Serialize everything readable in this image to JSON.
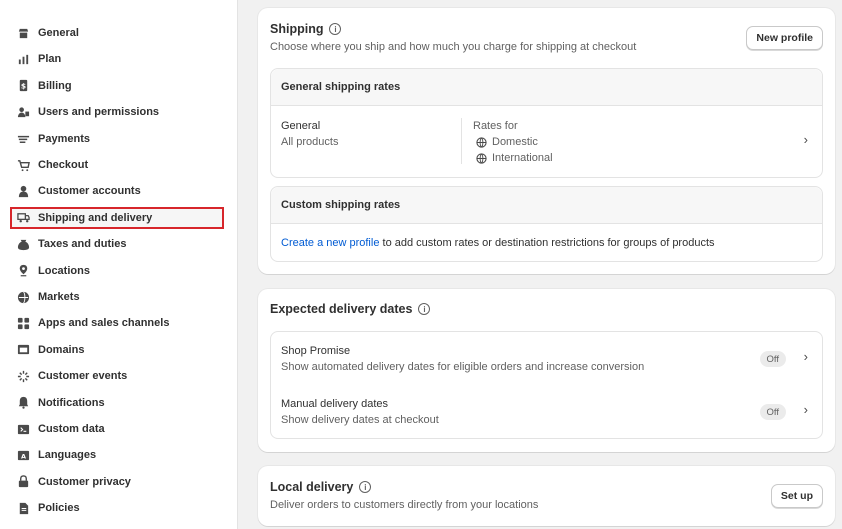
{
  "sidebar": {
    "items": [
      {
        "label": "General",
        "icon": "store-icon"
      },
      {
        "label": "Plan",
        "icon": "plan-icon"
      },
      {
        "label": "Billing",
        "icon": "billing-icon"
      },
      {
        "label": "Users and permissions",
        "icon": "users-icon"
      },
      {
        "label": "Payments",
        "icon": "payments-icon"
      },
      {
        "label": "Checkout",
        "icon": "cart-icon"
      },
      {
        "label": "Customer accounts",
        "icon": "person-icon"
      },
      {
        "label": "Shipping and delivery",
        "icon": "truck-icon"
      },
      {
        "label": "Taxes and duties",
        "icon": "tax-icon"
      },
      {
        "label": "Locations",
        "icon": "location-icon"
      },
      {
        "label": "Markets",
        "icon": "globe-icon"
      },
      {
        "label": "Apps and sales channels",
        "icon": "apps-icon"
      },
      {
        "label": "Domains",
        "icon": "domains-icon"
      },
      {
        "label": "Customer events",
        "icon": "events-icon"
      },
      {
        "label": "Notifications",
        "icon": "bell-icon"
      },
      {
        "label": "Custom data",
        "icon": "data-icon"
      },
      {
        "label": "Languages",
        "icon": "language-icon"
      },
      {
        "label": "Customer privacy",
        "icon": "lock-icon"
      },
      {
        "label": "Policies",
        "icon": "policy-icon"
      }
    ],
    "active_index": 7
  },
  "shipping": {
    "title": "Shipping",
    "subtitle": "Choose where you ship and how much you charge for shipping at checkout",
    "new_profile": "New profile",
    "general_rates": {
      "heading": "General shipping rates",
      "profile_name": "General",
      "profile_desc": "All products",
      "rates_for_label": "Rates for",
      "zones": [
        "Domestic",
        "International"
      ]
    },
    "custom_rates": {
      "heading": "Custom shipping rates",
      "link": "Create a new profile",
      "text": " to add custom rates or destination restrictions for groups of products"
    }
  },
  "delivery_dates": {
    "title": "Expected delivery dates",
    "rows": [
      {
        "title": "Shop Promise",
        "desc": "Show automated delivery dates for eligible orders and increase conversion",
        "status": "Off"
      },
      {
        "title": "Manual delivery dates",
        "desc": "Show delivery dates at checkout",
        "status": "Off"
      }
    ]
  },
  "local_delivery": {
    "title": "Local delivery",
    "subtitle": "Deliver orders to customers directly from your locations",
    "button": "Set up"
  },
  "colors": {
    "active_outline": "#d7262b",
    "link": "#005bd3",
    "background": "#f1f1f1"
  }
}
